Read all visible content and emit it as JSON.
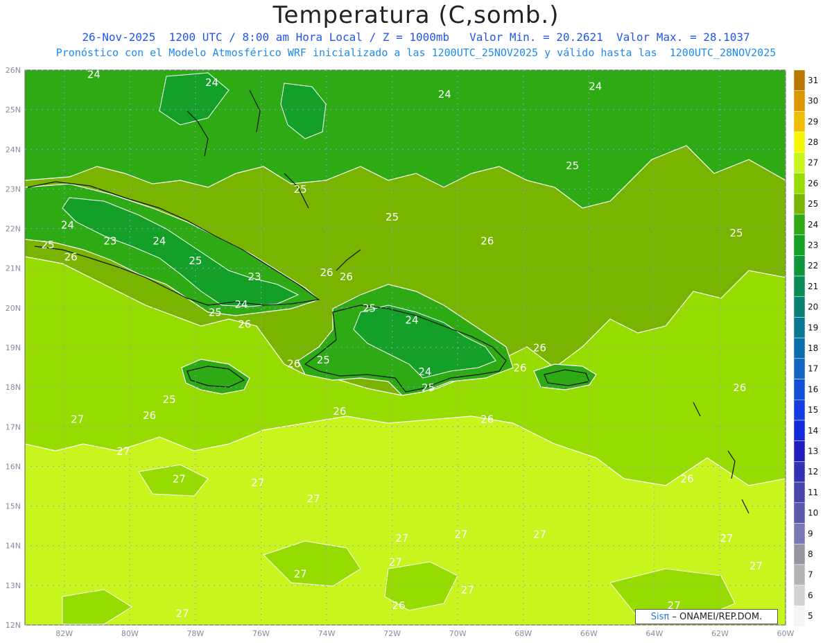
{
  "title": "Temperatura (C,somb.)",
  "subtitle_line1": "26-Nov-2025  1200 UTC / 8:00 am Hora Local / Z = 1000mb   Valor Min. = 20.2621  Valor Max. = 28.1037",
  "subtitle_line2": "Pronóstico con el Modelo Atmosférico WRF inicializado a las 1200UTC_25NOV2025 y válido hasta las  1200UTC_28NOV2025",
  "map": {
    "lon_range": [
      -83.2,
      -60
    ],
    "lat_range": [
      12,
      26
    ],
    "lat_labels": [
      "26N",
      "25N",
      "24N",
      "23N",
      "22N",
      "21N",
      "20N",
      "19N",
      "18N",
      "17N",
      "16N",
      "15N",
      "14N",
      "13N",
      "12N"
    ],
    "lon_labels": [
      "82W",
      "80W",
      "78W",
      "76W",
      "74W",
      "72W",
      "70W",
      "68W",
      "66W",
      "64W",
      "62W",
      "60W"
    ],
    "contour_labels": [
      {
        "text": "24",
        "lon": -81.1,
        "lat": 25.8
      },
      {
        "text": "24",
        "lon": -77.5,
        "lat": 25.6
      },
      {
        "text": "24",
        "lon": -70.4,
        "lat": 25.3
      },
      {
        "text": "24",
        "lon": -65.8,
        "lat": 25.5
      },
      {
        "text": "25",
        "lon": -66.5,
        "lat": 23.5
      },
      {
        "text": "25",
        "lon": -74.8,
        "lat": 22.9
      },
      {
        "text": "25",
        "lon": -72.0,
        "lat": 22.2
      },
      {
        "text": "25",
        "lon": -61.5,
        "lat": 21.8
      },
      {
        "text": "24",
        "lon": -81.9,
        "lat": 22.0
      },
      {
        "text": "23",
        "lon": -80.6,
        "lat": 21.6
      },
      {
        "text": "24",
        "lon": -79.1,
        "lat": 21.6
      },
      {
        "text": "25",
        "lon": -82.5,
        "lat": 21.5
      },
      {
        "text": "26",
        "lon": -81.8,
        "lat": 21.2
      },
      {
        "text": "25",
        "lon": -78.0,
        "lat": 21.1
      },
      {
        "text": "23",
        "lon": -76.2,
        "lat": 20.7
      },
      {
        "text": "26",
        "lon": -74.0,
        "lat": 20.8
      },
      {
        "text": "26",
        "lon": -73.4,
        "lat": 20.7
      },
      {
        "text": "26",
        "lon": -69.1,
        "lat": 21.6
      },
      {
        "text": "24",
        "lon": -76.6,
        "lat": 20.0
      },
      {
        "text": "25",
        "lon": -77.4,
        "lat": 19.8
      },
      {
        "text": "26",
        "lon": -76.5,
        "lat": 19.5
      },
      {
        "text": "25",
        "lon": -72.7,
        "lat": 19.9
      },
      {
        "text": "24",
        "lon": -71.4,
        "lat": 19.6
      },
      {
        "text": "26",
        "lon": -67.5,
        "lat": 18.9
      },
      {
        "text": "26",
        "lon": -75.0,
        "lat": 18.5
      },
      {
        "text": "25",
        "lon": -74.1,
        "lat": 18.6
      },
      {
        "text": "24",
        "lon": -71.0,
        "lat": 18.3
      },
      {
        "text": "26",
        "lon": -68.1,
        "lat": 18.4
      },
      {
        "text": "25",
        "lon": -70.9,
        "lat": 17.9
      },
      {
        "text": "26",
        "lon": -61.4,
        "lat": 17.9
      },
      {
        "text": "25",
        "lon": -78.8,
        "lat": 17.6
      },
      {
        "text": "26",
        "lon": -79.4,
        "lat": 17.2
      },
      {
        "text": "26",
        "lon": -73.6,
        "lat": 17.3
      },
      {
        "text": "26",
        "lon": -69.1,
        "lat": 17.1
      },
      {
        "text": "27",
        "lon": -81.6,
        "lat": 17.1
      },
      {
        "text": "27",
        "lon": -80.2,
        "lat": 16.3
      },
      {
        "text": "27",
        "lon": -78.5,
        "lat": 15.6
      },
      {
        "text": "26",
        "lon": -63.0,
        "lat": 15.6
      },
      {
        "text": "27",
        "lon": -76.1,
        "lat": 15.5
      },
      {
        "text": "27",
        "lon": -74.4,
        "lat": 15.1
      },
      {
        "text": "27",
        "lon": -69.9,
        "lat": 14.2
      },
      {
        "text": "27",
        "lon": -67.5,
        "lat": 14.2
      },
      {
        "text": "27",
        "lon": -61.8,
        "lat": 14.1
      },
      {
        "text": "27",
        "lon": -71.9,
        "lat": 13.5
      },
      {
        "text": "27",
        "lon": -71.7,
        "lat": 14.1
      },
      {
        "text": "27",
        "lon": -74.8,
        "lat": 13.2
      },
      {
        "text": "27",
        "lon": -60.9,
        "lat": 13.4
      },
      {
        "text": "27",
        "lon": -69.7,
        "lat": 12.8
      },
      {
        "text": "26",
        "lon": -71.8,
        "lat": 12.4
      },
      {
        "text": "27",
        "lon": -78.4,
        "lat": 12.2
      },
      {
        "text": "27",
        "lon": -63.4,
        "lat": 12.4
      }
    ]
  },
  "colorbar": {
    "levels": [
      "31",
      "30",
      "29",
      "28",
      "27",
      "26",
      "25",
      "24",
      "23",
      "22",
      "21",
      "20",
      "19",
      "18",
      "17",
      "16",
      "15",
      "14",
      "13",
      "12",
      "11",
      "10",
      "9",
      "8",
      "7",
      "6",
      "5"
    ],
    "colors": [
      "#b87800",
      "#dc9600",
      "#f0be00",
      "#f5f500",
      "#c8f51e",
      "#96dc00",
      "#78b400",
      "#2daa14",
      "#14a028",
      "#0f963c",
      "#0a8c55",
      "#0a8273",
      "#0a7891",
      "#0a6eaa",
      "#1464c3",
      "#1450d7",
      "#143ce1",
      "#1428dc",
      "#1e1ebe",
      "#3232b4",
      "#4646aa",
      "#5a5aaa",
      "#7878b4",
      "#9696a0",
      "#b4b4b4",
      "#d2d2d2",
      "#f5f5f5"
    ]
  },
  "logo": {
    "sis": "Sisπ",
    "rest": "– ONAMEI/REP.DOM."
  }
}
